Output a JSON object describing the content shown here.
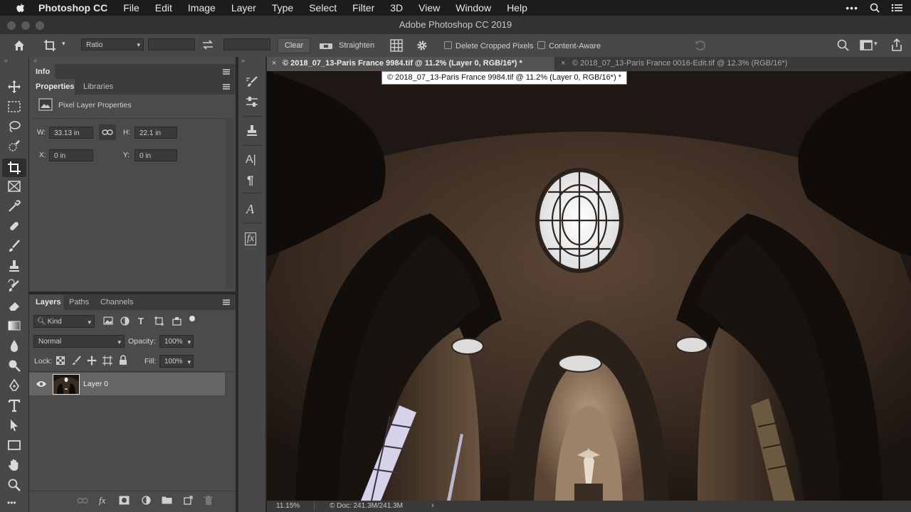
{
  "menubar": {
    "app_name": "Photoshop CC",
    "items": [
      "File",
      "Edit",
      "Image",
      "Layer",
      "Type",
      "Select",
      "Filter",
      "3D",
      "View",
      "Window",
      "Help"
    ]
  },
  "window": {
    "title": "Adobe Photoshop CC 2019"
  },
  "options_bar": {
    "ratio_select": "Ratio",
    "clear_label": "Clear",
    "straighten_label": "Straighten",
    "delete_cropped_label": "Delete Cropped Pixels",
    "content_aware_label": "Content-Aware"
  },
  "info_panel": {
    "tab": "Info"
  },
  "properties_panel": {
    "tabs": [
      "Properties",
      "Libraries"
    ],
    "section_title": "Pixel Layer Properties",
    "w_label": "W:",
    "w_value": "33.13 in",
    "h_label": "H:",
    "h_value": "22.1 in",
    "x_label": "X:",
    "x_value": "0 in",
    "y_label": "Y:",
    "y_value": "0 in"
  },
  "layers_panel": {
    "tabs": [
      "Layers",
      "Paths",
      "Channels"
    ],
    "kind_label": "Kind",
    "blend_mode": "Normal",
    "opacity_label": "Opacity:",
    "opacity_value": "100%",
    "lock_label": "Lock:",
    "fill_label": "Fill:",
    "fill_value": "100%",
    "layers": [
      {
        "name": "Layer 0"
      }
    ]
  },
  "documents": {
    "tabs": [
      {
        "label": "© 2018_07_13-Paris France 9984.tif @ 11.2% (Layer 0, RGB/16*) *",
        "active": true
      },
      {
        "label": "© 2018_07_13-Paris France 0016-Edit.tif @ 12.3% (RGB/16*)",
        "active": false
      }
    ],
    "tooltip": "© 2018_07_13-Paris France 9984.tif @ 11.2% (Layer 0, RGB/16*) *"
  },
  "status_bar": {
    "zoom": "11.15%",
    "doc_info": "© Doc: 241.3M/241.3M"
  },
  "colors": {
    "accent": "#4b4b4b",
    "panel_dark": "#3c3c3c",
    "canvas": "#202020"
  }
}
